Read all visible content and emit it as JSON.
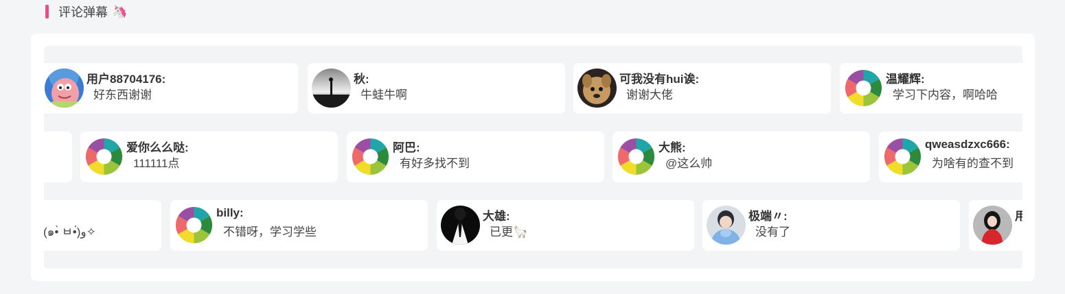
{
  "section": {
    "title": "评论弹幕",
    "emoji": "🦄"
  },
  "rows": [
    [
      {
        "name": "用户88704176:",
        "message": "好东西谢谢",
        "avatar": "patrick-star-avatar"
      },
      {
        "name": "秋:",
        "message": "牛蛙牛啊",
        "avatar": "silhouette-photo-avatar"
      },
      {
        "name": "可我没有hui诶:",
        "message": "谢谢大佬",
        "avatar": "dog-photo-avatar"
      },
      {
        "name": "温耀辉:",
        "message": "学习下内容，啊哈哈",
        "avatar": "default-avatar"
      }
    ],
    [
      {
        "name": "",
        "message": "",
        "avatar": ""
      },
      {
        "name": "爱你么么哒:",
        "message": "111111点",
        "avatar": "default-avatar"
      },
      {
        "name": "阿巴:",
        "message": "有好多找不到",
        "avatar": "default-avatar"
      },
      {
        "name": "大熊:",
        "message": "@这么帅",
        "avatar": "default-avatar"
      },
      {
        "name": "qweasdzxc666:",
        "message": "为啥有的查不到",
        "avatar": "default-avatar"
      }
    ],
    [
      {
        "name": "",
        "message": "(๑•̀ ㅂ•́)و✧",
        "avatar": ""
      },
      {
        "name": "billy:",
        "message": "不错呀，学习学些",
        "avatar": "default-avatar"
      },
      {
        "name": "大雄:",
        "message": "已更🦙",
        "avatar": "suit-photo-avatar"
      },
      {
        "name": "极端〃:",
        "message": "没有了",
        "avatar": "person-photo-avatar"
      },
      {
        "name": "用",
        "message": "",
        "avatar": "girl-photo-avatar"
      }
    ]
  ]
}
